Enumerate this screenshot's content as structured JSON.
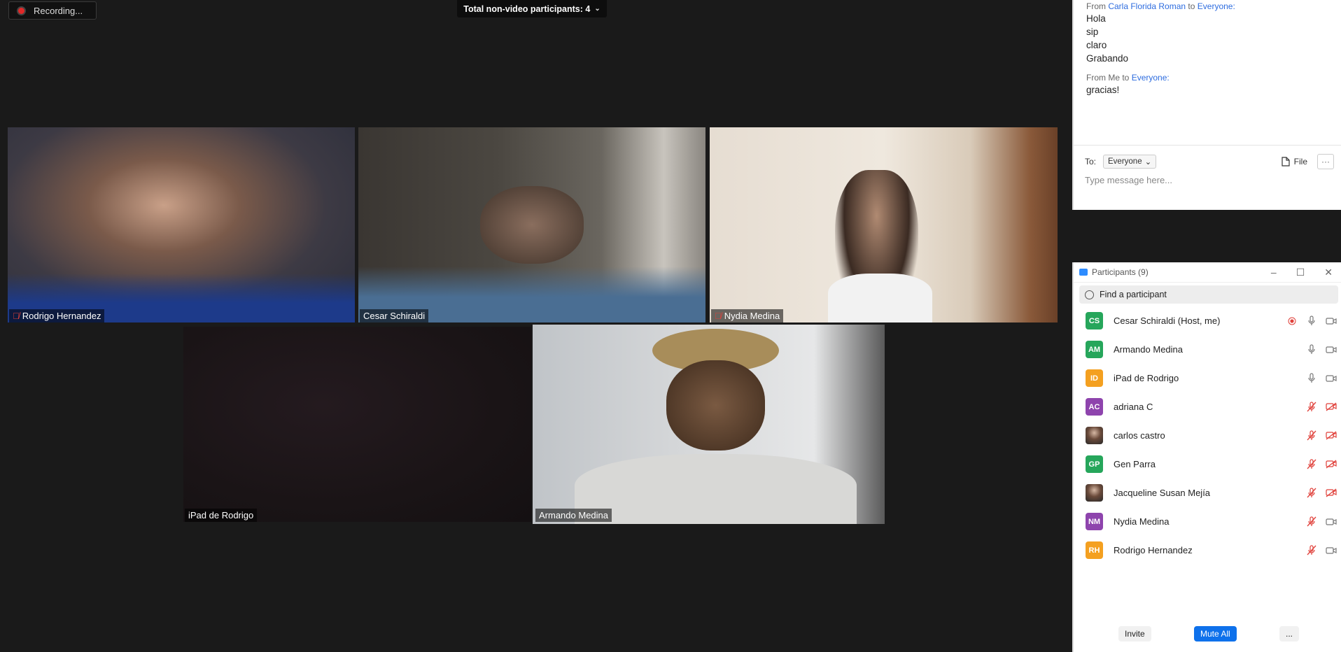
{
  "recording": {
    "label": "Recording..."
  },
  "top_bar": {
    "label": "Total non-video participants: 4"
  },
  "tiles": [
    {
      "name": "Rodrigo Hernandez",
      "muted": true
    },
    {
      "name": "Cesar Schiraldi",
      "muted": false
    },
    {
      "name": "Nydia Medina",
      "muted": true
    },
    {
      "name": "iPad de Rodrigo",
      "muted": false
    },
    {
      "name": "Armando Medina",
      "muted": false,
      "active_speaker": true
    }
  ],
  "chat": {
    "messages": [
      {
        "from_prefix": "From",
        "sender": "Carla Florida Roman",
        "to_word": "to",
        "recipient": "Everyone:",
        "lines": [
          "Hola",
          "sip",
          "claro",
          "Grabando"
        ]
      },
      {
        "from_prefix": "From Me to",
        "recipient": "Everyone:",
        "lines": [
          "gracias!"
        ]
      }
    ],
    "to_label": "To:",
    "to_value": "Everyone",
    "file_label": "File",
    "more_label": "···",
    "input_placeholder": "Type message here..."
  },
  "participants": {
    "title": "Participants (9)",
    "search_placeholder": "Find a participant",
    "list": [
      {
        "initials": "CS",
        "name": "Cesar Schiraldi (Host, me)",
        "color": "#26a65b",
        "recording": true,
        "mic": "on",
        "video": "on"
      },
      {
        "initials": "AM",
        "name": "Armando Medina",
        "color": "#26a65b",
        "mic": "on",
        "video": "on"
      },
      {
        "initials": "ID",
        "name": "iPad de Rodrigo",
        "color": "#f4a020",
        "mic": "on",
        "video": "on"
      },
      {
        "initials": "AC",
        "name": "adriana C",
        "color": "#8e44ad",
        "mic": "off",
        "video": "off"
      },
      {
        "initials": "",
        "name": "carlos castro",
        "photo": true,
        "mic": "off",
        "video": "off"
      },
      {
        "initials": "GP",
        "name": "Gen Parra",
        "color": "#26a65b",
        "mic": "off",
        "video": "off"
      },
      {
        "initials": "",
        "name": "Jacqueline Susan Mejía",
        "photo": true,
        "mic": "off",
        "video": "off"
      },
      {
        "initials": "NM",
        "name": "Nydia Medina",
        "color": "#8e44ad",
        "mic": "off",
        "video": "on"
      },
      {
        "initials": "RH",
        "name": "Rodrigo Hernandez",
        "color": "#f4a020",
        "mic": "off",
        "video": "on"
      }
    ],
    "invite_label": "Invite",
    "mute_all_label": "Mute All",
    "more_label": "..."
  }
}
